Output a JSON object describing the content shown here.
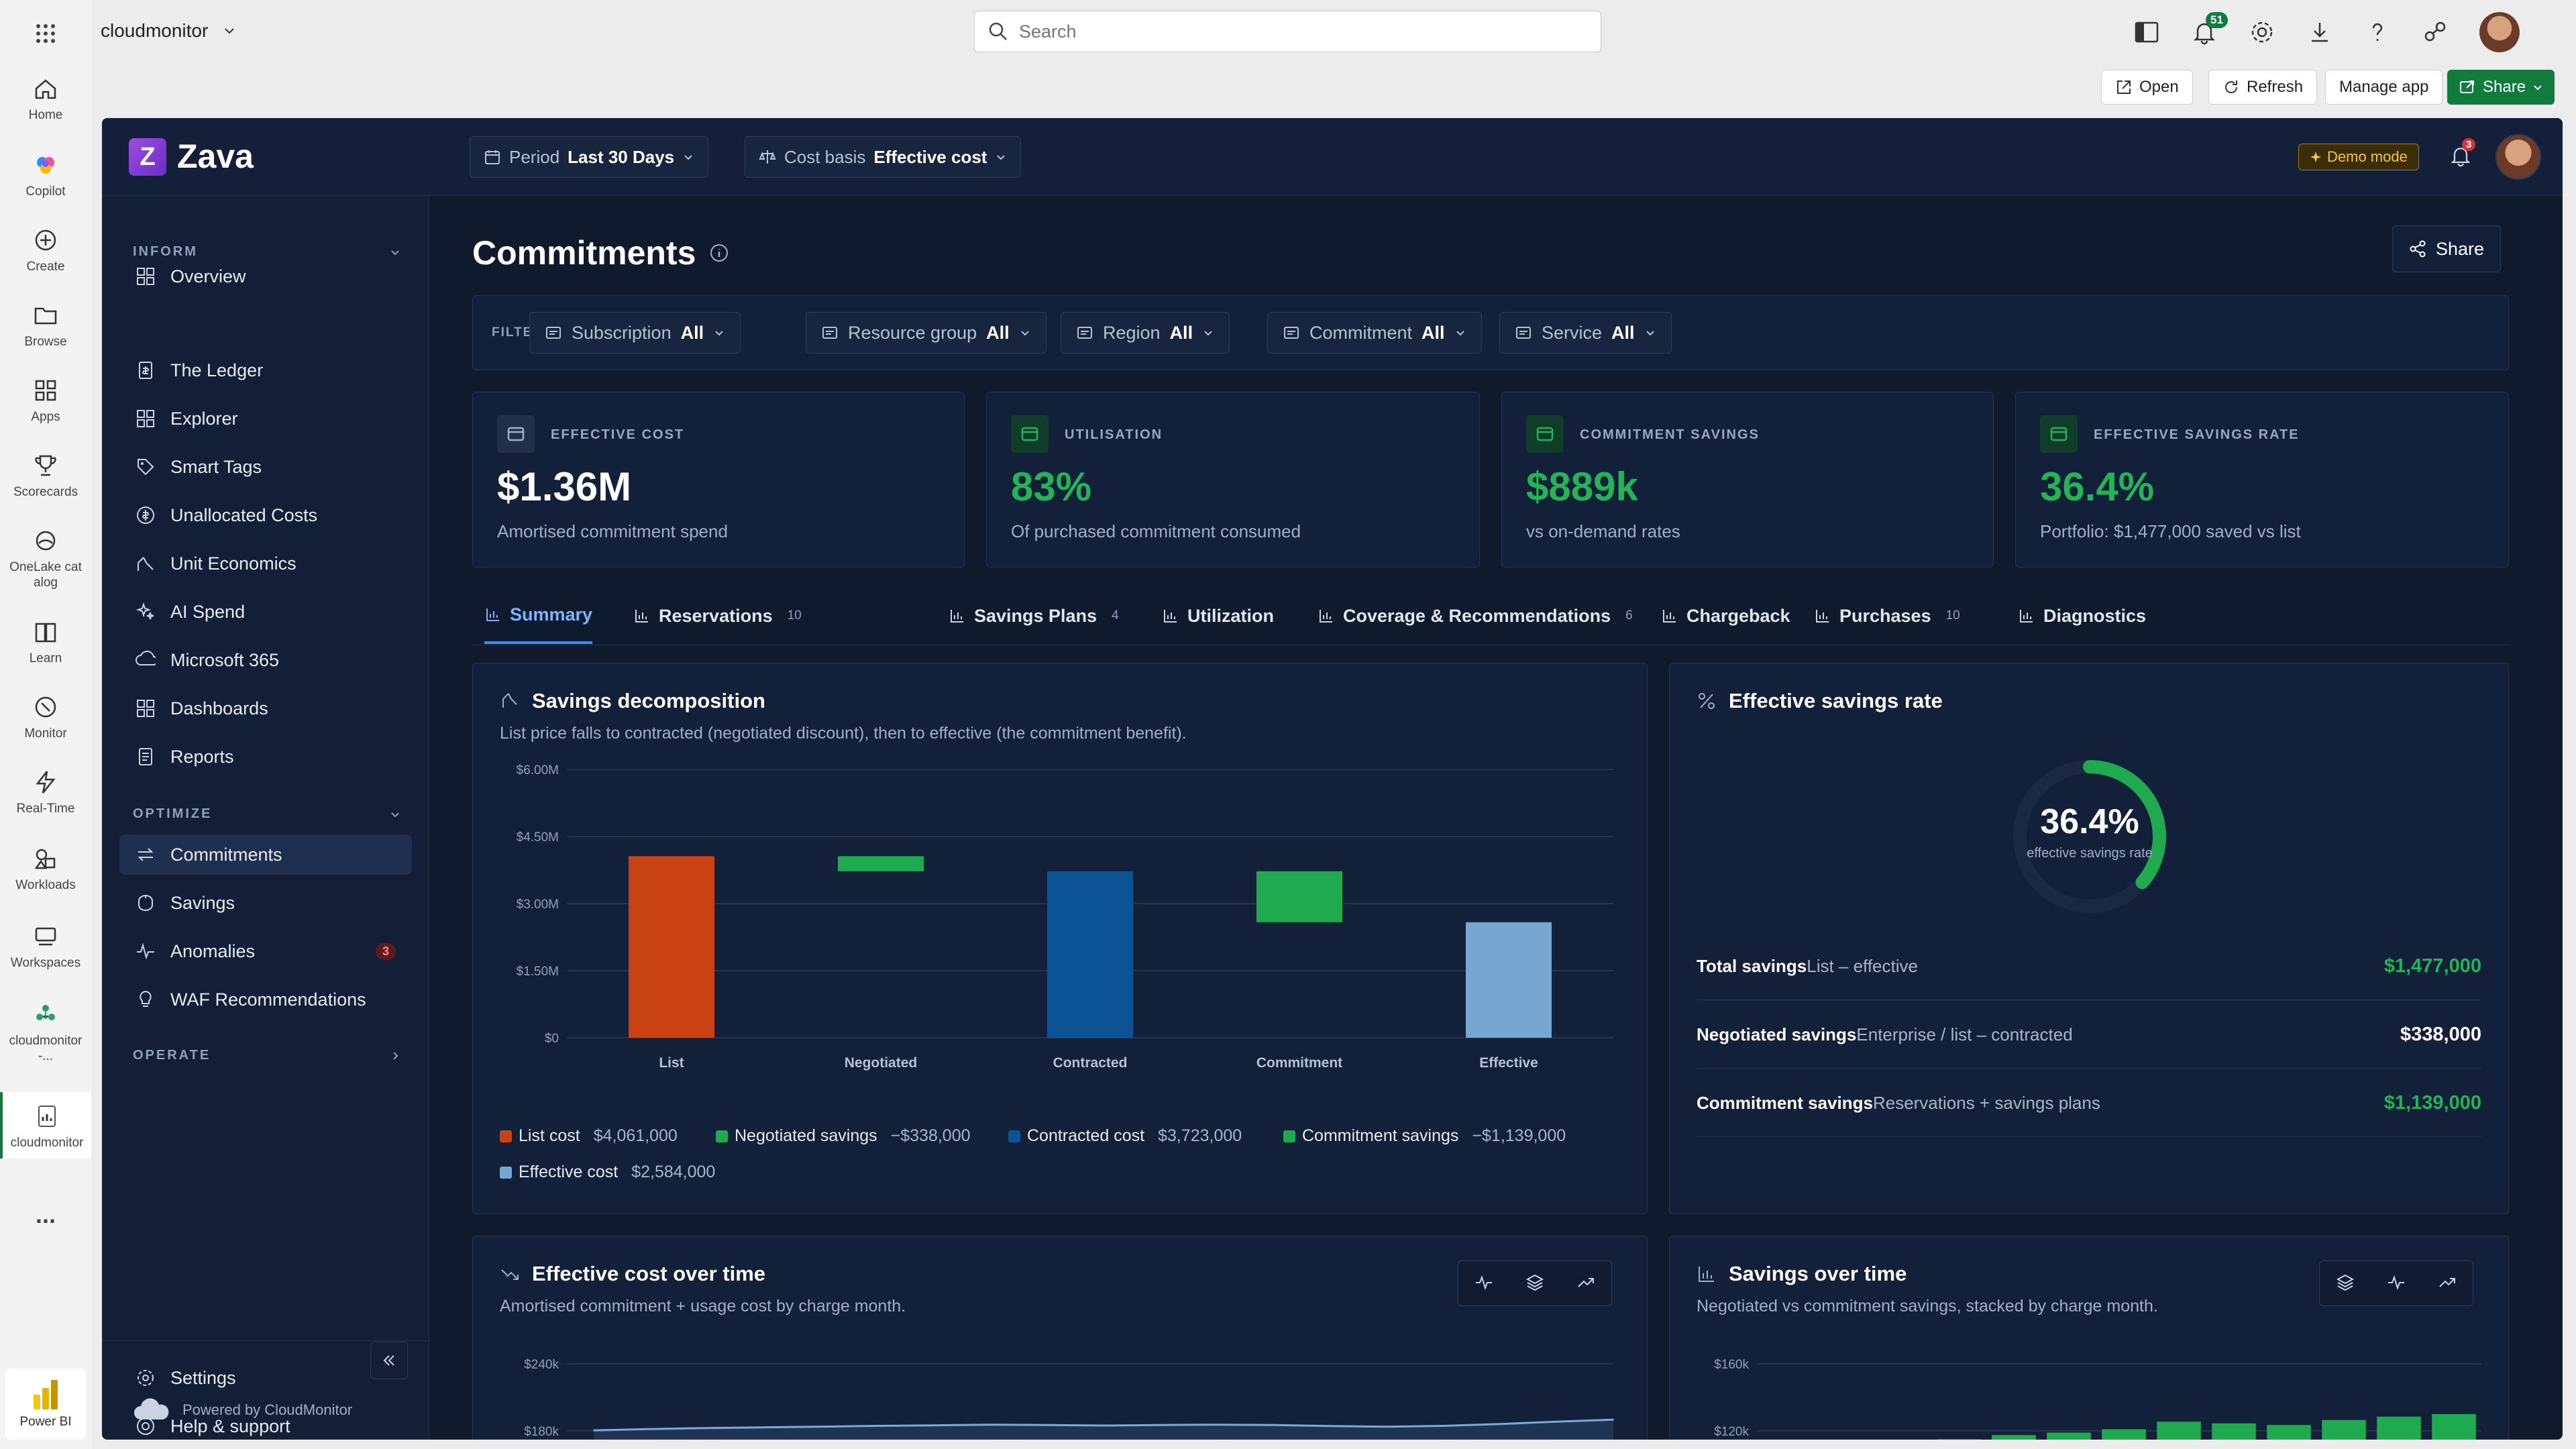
{
  "shell": {
    "app_name": "cloudmonitor",
    "search_placeholder": "Search",
    "notifications_count": "51",
    "buttons": {
      "open": "Open",
      "refresh": "Refresh",
      "manage_app": "Manage app",
      "share": "Share"
    }
  },
  "rail": {
    "items": [
      {
        "label": "Home",
        "icon": "home-icon"
      },
      {
        "label": "Copilot",
        "icon": "copilot-icon"
      },
      {
        "label": "Create",
        "icon": "plus-circle-icon"
      },
      {
        "label": "Browse",
        "icon": "folder-icon"
      },
      {
        "label": "Apps",
        "icon": "apps-icon"
      },
      {
        "label": "Scorecards",
        "icon": "trophy-icon"
      },
      {
        "label": "OneLake catalog",
        "icon": "onelake-icon"
      },
      {
        "label": "Learn",
        "icon": "book-icon"
      },
      {
        "label": "Monitor",
        "icon": "monitor-icon"
      },
      {
        "label": "Real-Time",
        "icon": "lightning-icon"
      },
      {
        "label": "Workloads",
        "icon": "workloads-icon"
      },
      {
        "label": "Workspaces",
        "icon": "workspaces-icon"
      },
      {
        "label": "cloudmonitor-...",
        "icon": "workspace-icon"
      },
      {
        "label": "cloudmonitor",
        "icon": "report-icon"
      }
    ],
    "more": "...",
    "powerbi": "Power BI"
  },
  "report": {
    "brand": "Zava",
    "brand_letter": "Z",
    "period_label": "Period",
    "period_value": "Last 30 Days",
    "cost_basis_label": "Cost basis",
    "cost_basis_value": "Effective cost",
    "demo_mode": "Demo mode",
    "alert_count": "3"
  },
  "sidebar": {
    "overview": "Overview",
    "inform_label": "INFORM",
    "inform": [
      "The Ledger",
      "Explorer",
      "Smart Tags",
      "Unallocated Costs",
      "Unit Economics",
      "AI Spend",
      "Microsoft 365",
      "Dashboards",
      "Reports"
    ],
    "optimize_label": "OPTIMIZE",
    "optimize": [
      "Commitments",
      "Savings",
      "Anomalies",
      "WAF Recommendations"
    ],
    "anomalies_badge": "3",
    "operate_label": "OPERATE",
    "settings": "Settings",
    "help": "Help & support",
    "powered_by": "Powered by CloudMonitor"
  },
  "page": {
    "title": "Commitments",
    "share": "Share",
    "filters_label": "FILTERS",
    "filters": [
      {
        "label": "Subscription",
        "value": "All"
      },
      {
        "label": "Resource group",
        "value": "All"
      },
      {
        "label": "Region",
        "value": "All"
      },
      {
        "label": "Commitment",
        "value": "All"
      },
      {
        "label": "Service",
        "value": "All"
      }
    ]
  },
  "kpis": [
    {
      "label": "EFFECTIVE COST",
      "value": "$1.36M",
      "sub": "Amortised commitment spend",
      "color": "#ffffff"
    },
    {
      "label": "UTILISATION",
      "value": "83%",
      "sub": "Of purchased commitment consumed",
      "color": "#22b455"
    },
    {
      "label": "COMMITMENT SAVINGS",
      "value": "$889k",
      "sub": "vs on-demand rates",
      "color": "#22b455"
    },
    {
      "label": "EFFECTIVE SAVINGS RATE",
      "value": "36.4%",
      "sub": "Portfolio: $1,477,000 saved vs list",
      "color": "#22b455"
    }
  ],
  "tabs": [
    {
      "label": "Summary",
      "count": ""
    },
    {
      "label": "Reservations",
      "count": "10"
    },
    {
      "label": "Savings Plans",
      "count": "4"
    },
    {
      "label": "Utilization",
      "count": ""
    },
    {
      "label": "Coverage & Recommendations",
      "count": "6"
    },
    {
      "label": "Chargeback",
      "count": ""
    },
    {
      "label": "Purchases",
      "count": "10"
    },
    {
      "label": "Diagnostics",
      "count": ""
    }
  ],
  "decomposition": {
    "title": "Savings decomposition",
    "subtitle": "List price falls to contracted (negotiated discount), then to effective (the commitment benefit).",
    "legend": [
      {
        "name": "List cost",
        "value": "$4,061,000",
        "color": "#c94312"
      },
      {
        "name": "Negotiated savings",
        "value": "−$338,000",
        "color": "#1faa4f"
      },
      {
        "name": "Contracted cost",
        "value": "$3,723,000",
        "color": "#0b5394"
      },
      {
        "name": "Commitment savings",
        "value": "−$1,139,000",
        "color": "#1faa4f"
      },
      {
        "name": "Effective cost",
        "value": "$2,584,000",
        "color": "#77a6d1"
      }
    ]
  },
  "savings_rate": {
    "title": "Effective savings rate",
    "value": "36.4%",
    "caption": "effective savings rate",
    "fraction": 0.364,
    "rows": [
      {
        "key": "Total savings",
        "desc": "List – effective",
        "value": "$1,477,000",
        "color": "#22b455"
      },
      {
        "key": "Negotiated savings",
        "desc": "Enterprise / list – contracted",
        "value": "$338,000",
        "color": "#ffffff"
      },
      {
        "key": "Commitment savings",
        "desc": "Reservations + savings plans",
        "value": "$1,139,000",
        "color": "#22b455"
      }
    ]
  },
  "cost_over_time": {
    "title": "Effective cost over time",
    "subtitle": "Amortised commitment + usage cost by charge month."
  },
  "savings_over_time": {
    "title": "Savings over time",
    "subtitle": "Negotiated vs commitment savings, stacked by charge month."
  },
  "chart_data": [
    {
      "type": "bar",
      "title": "Savings decomposition",
      "categories": [
        "List",
        "Negotiated",
        "Contracted",
        "Commitment",
        "Effective"
      ],
      "series": [
        {
          "values": [
            4061000,
            -338000,
            3723000,
            -1139000,
            2584000
          ]
        }
      ],
      "ylim": [
        0,
        6000000
      ],
      "ytick_labels": [
        "$0",
        "$1.50M",
        "$3.00M",
        "$4.50M",
        "$6.00M"
      ],
      "waterfall": true,
      "grid": true
    },
    {
      "type": "area",
      "title": "Effective cost over time",
      "ytick_labels": [
        "$180k",
        "$240k"
      ],
      "values": [
        180500,
        181700,
        182600,
        183200,
        183800,
        184500,
        185000,
        185600,
        185200,
        184800,
        185300,
        185600,
        185200,
        184400,
        183700,
        184500,
        186200,
        188300,
        190000
      ]
    },
    {
      "type": "bar",
      "title": "Savings over time",
      "ytick_labels": [
        "$120k",
        "$160k"
      ],
      "values": [
        115000,
        117500,
        119000,
        121000,
        125500,
        124500,
        123500,
        126500,
        128500,
        130000
      ]
    }
  ]
}
